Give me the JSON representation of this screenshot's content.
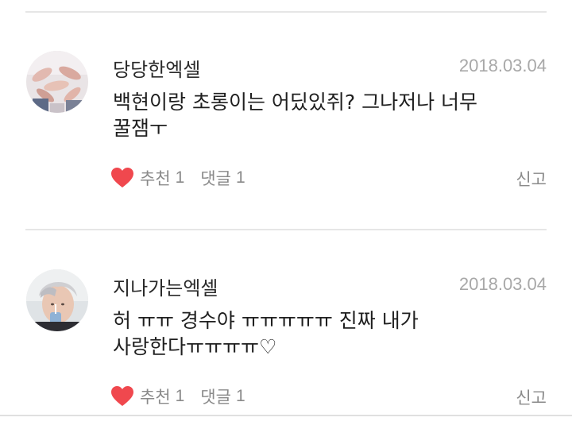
{
  "comments": [
    {
      "nickname": "당당한엑셀",
      "date": "2018.03.04",
      "text": "백현이랑 초롱이는 어딨있쥐? 그나저나 너무\n꿀잼ㅜ",
      "recommend_label": "추천",
      "recommend_count": "1",
      "reply_label": "댓글",
      "reply_count": "1",
      "report_label": "신고",
      "avatar_icon": "hands-group-photo-avatar"
    },
    {
      "nickname": "지나가는엑셀",
      "date": "2018.03.04",
      "text": "허 ㅠㅠ 경수야 ㅠㅠㅠㅠㅠ 진짜 내가\n사랑한다ㅠㅠㅠㅠ♡",
      "recommend_label": "추천",
      "recommend_count": "1",
      "reply_label": "댓글",
      "reply_count": "1",
      "report_label": "신고",
      "avatar_icon": "person-drinking-avatar"
    }
  ],
  "colors": {
    "heart": "#f0484e",
    "date": "#a8a8a8",
    "meta": "#8a8a8a",
    "divider": "#e6e6e6"
  }
}
